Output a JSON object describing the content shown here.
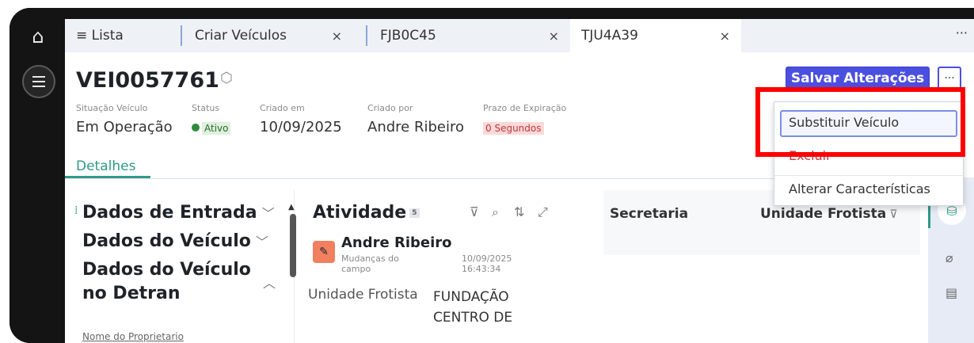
{
  "nav": {
    "home_icon": "home-icon",
    "menu_icon": "hamburger-menu-icon"
  },
  "tabs": [
    {
      "label": "≡ Lista",
      "active": false,
      "closable": false
    },
    {
      "label": "Criar Veículos",
      "active": false,
      "closable": true
    },
    {
      "label": "FJB0C45",
      "active": false,
      "closable": true
    },
    {
      "label": "TJU4A39",
      "active": true,
      "closable": true
    }
  ],
  "tab_close_glyph": "×",
  "tab_overflow_label": "···",
  "record": {
    "title": "VEI0057761",
    "fields": [
      {
        "label": "Situação Veículo",
        "value": "Em Operação"
      },
      {
        "label": "Status",
        "value": "Ativo"
      },
      {
        "label": "Criado em",
        "value": "10/09/2025"
      },
      {
        "label": "Criado por",
        "value": "Andre Ribeiro"
      },
      {
        "label": "Prazo de Expiração",
        "value": "0 Segundos"
      }
    ]
  },
  "detail_tab": "Detalhes",
  "actions": {
    "save_label": "Salvar Alterações",
    "more_label": "···",
    "menu_items": [
      "Substituir Veículo",
      "Excluir",
      "Alterar Características"
    ]
  },
  "sections": {
    "items": [
      "Dados de Entrada",
      "Dados do Veículo",
      "Dados do Veículo",
      "no Detran"
    ],
    "owner_label": "Nome do Proprietario"
  },
  "activity": {
    "title": "Atividade",
    "count": "5",
    "entry": {
      "user": "Andre Ribeiro",
      "description": "Mudanças do campo",
      "datetime": "10/09/2025 16:43:34",
      "field": "Unidade Frotista",
      "value": "FUNDAÇÃO CENTRO DE"
    }
  },
  "right_panel": {
    "col1": "Secretaria",
    "col2": "Unidade Frotista"
  },
  "colors": {
    "primary": "#4b4fe0",
    "accent": "#2e9a88",
    "highlight_box": "#ff0000",
    "status_active": "#2e8b3a",
    "expiry_badge_bg": "#fbd9d9"
  }
}
